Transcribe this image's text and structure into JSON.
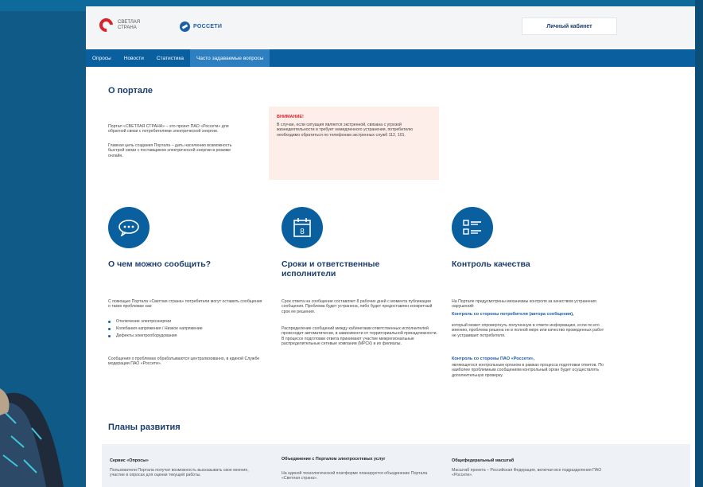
{
  "header": {
    "logo1_text": "СВЕТЛАЯ СТРАНА",
    "logo2_text": "РОССЕТИ",
    "cabinet_button": "Личный кабинет"
  },
  "nav": {
    "items": [
      {
        "label": "Опросы"
      },
      {
        "label": "Новости"
      },
      {
        "label": "Статистика"
      },
      {
        "label": "Часто задаваемые вопросы"
      }
    ]
  },
  "portal": {
    "title": "О портале",
    "p1": "Портал «СВЕТЛАЯ СТРАНА» – это проект ПАО «Россети» для обратной связи с потребителями электрической энергии.",
    "p2": "Главная цель создания Портала – дать населению возможность быстрой связи с поставщиком электрической энергии в режиме онлайн.",
    "warning_title": "ВНИМАНИЕ!",
    "warning_text": "В случае, если ситуация является экстренной, связана с угрозой жизнедеятельности и требует немедленного устранения, потребителю необходимо обратиться по телефонам экстренных служб 112, 101."
  },
  "features": [
    {
      "title": "О чем можно сообщить?",
      "intro": "С помощью Портала «Светлая страна» потребители могут оставить сообщения о таких проблемах как:",
      "bullets": [
        "Отключение электроэнергии",
        "Колебания напряжения / Низкое напряжение",
        "Дефекты электрооборудования"
      ],
      "outro": "Сообщения о проблемах обрабатываются централизованно, в единой Службе модерации ПАО «Россети»."
    },
    {
      "title": "Сроки и ответственные исполнители",
      "p1": "Срок ответа на сообщение составляет 8 рабочих дней с момента публикации сообщения. Проблема будет устранена, либо будет предоставлен конкретный срок ее решения.",
      "p2": "Распределение сообщений между кабинетами ответственных исполнителей происходит автоматически, в зависимости от территориальной принадлежности. В процессе подготовки ответа принимают участие межрегиональные распределительные сетевые компании (МРСК) и их филиалы."
    },
    {
      "title": "Контроль качества",
      "p1": "На Портале предусмотрены механизмы контроля за качеством устранения нарушений:",
      "sub1": "Контроль со стороны потребителя (автора сообщения),",
      "p2": "который может опровергнуть полученную в ответе информацию, если по его мнению, проблема решена не в полной мере или качество проведенных работ не устраивает потребителя.",
      "sub2": "Контроль со стороны ПАО «Россети»,",
      "p3": "являющегося контрольным органом в рамках процесса подготовки ответов. По наиболее проблемным сообщениям контрольный орган будет осуществлять дополнительную проверку."
    }
  ],
  "plans": {
    "title": "Планы развития",
    "items": [
      {
        "title": "Сервис «Опросы»",
        "text": "Пользователи Портала получат возможность высказывать свое мнение, участие в опросах для оценки текущей работы."
      },
      {
        "title": "Объединение с Порталом электросетевых услуг",
        "text": "На единой технологической платформе планируется объединение Портала «Светлая страна»."
      },
      {
        "title": "Общефедеральный масштаб",
        "text": "Масштаб проекта – Российская Федерация, включая все подразделения ПАО «Россети»."
      }
    ]
  },
  "colors": {
    "nav_bg": "#0a5f9f",
    "nav_active": "#2d7fc0",
    "heading": "#1b3d6e",
    "warning_bg": "#fdeeea",
    "warning_title": "#d8232a",
    "icon_circle": "#0a5f9f"
  }
}
